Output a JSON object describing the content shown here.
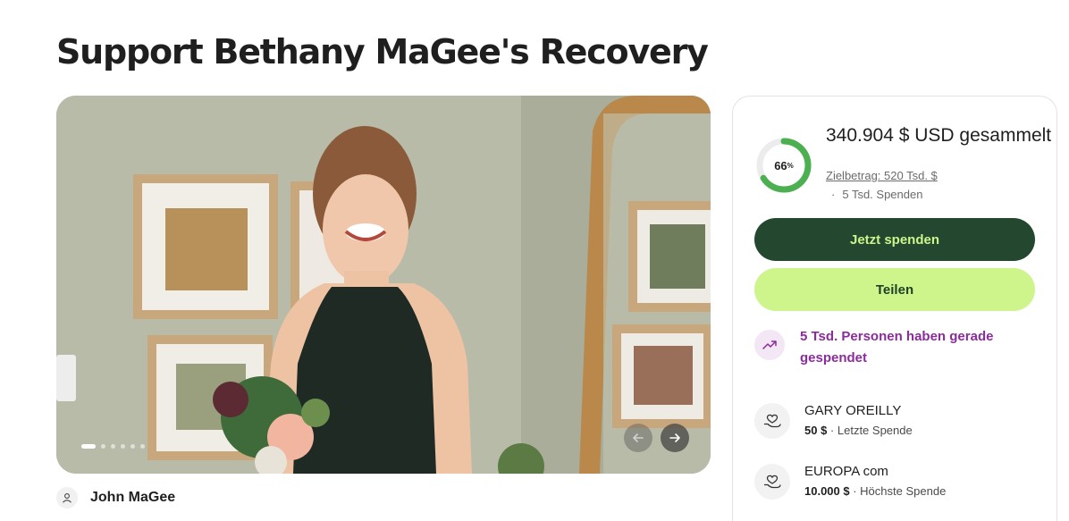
{
  "page": {
    "title": "Support Bethany MaGee's Recovery"
  },
  "gallery": {
    "image_alt": "Smiling young woman in a dark green dress holding a bouquet of flowers",
    "slide_count": 6,
    "active_slide": 1
  },
  "organizer": {
    "name": "John MaGee"
  },
  "donation": {
    "percent_label": "66",
    "percent_sign": "%",
    "percent_value": 0.66,
    "raised": "340.904 $ USD gesammelt",
    "goal": "Zielbetrag: 520 Tsd. $",
    "separator": "·",
    "donation_count": "5 Tsd. Spenden",
    "donate_label": "Jetzt spenden",
    "share_label": "Teilen",
    "trend_text": "5 Tsd. Personen haben gerade gespendet",
    "donors": [
      {
        "name": "GARY OREILLY",
        "amount": "50 $",
        "sep": " · ",
        "note": "Letzte Spende"
      },
      {
        "name": "EUROPA com",
        "amount": "10.000 $",
        "sep": " · ",
        "note": "Höchste Spende"
      }
    ]
  },
  "colors": {
    "brand_dark": "#24472f",
    "brand_light": "#cdf58c",
    "progress": "#4caf50",
    "trend_purple": "#8a2c9a"
  },
  "icons": {
    "organizer": "person-icon",
    "trend": "trending-up-icon",
    "donor": "heart-hand-icon",
    "prev": "arrow-left-icon",
    "next": "arrow-right-icon"
  }
}
